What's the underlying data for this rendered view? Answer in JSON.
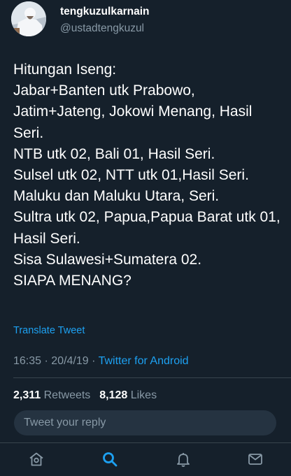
{
  "user": {
    "display_name": "tengkuzulkarnain",
    "handle": "@ustadtengkuzul"
  },
  "tweet": {
    "text": "Hitungan Iseng:\nJabar+Banten utk Prabowo,\nJatim+Jateng, Jokowi Menang, Hasil Seri.\nNTB utk 02, Bali 01, Hasil Seri.\nSulsel utk 02, NTT utk 01,Hasil Seri.\nMaluku dan Maluku Utara, Seri.\nSultra utk 02, Papua,Papua Barat utk 01, Hasil Seri.\nSisa Sulawesi+Sumatera 02.\nSIAPA MENANG?",
    "translate_label": "Translate Tweet",
    "time": "16:35",
    "date": "20/4/19",
    "separator": "·",
    "source": "Twitter for Android"
  },
  "stats": {
    "retweets_count": "2,311",
    "retweets_label": "Retweets",
    "likes_count": "8,128",
    "likes_label": "Likes"
  },
  "reply": {
    "placeholder": "Tweet your reply"
  },
  "nav": {
    "items": [
      {
        "icon": "home-icon",
        "active": false
      },
      {
        "icon": "search-icon",
        "active": true
      },
      {
        "icon": "notifications-icon",
        "active": false
      },
      {
        "icon": "messages-icon",
        "active": false
      }
    ]
  },
  "colors": {
    "background": "#15202b",
    "accent": "#1da1f2",
    "secondary_text": "#8899a6",
    "divider": "#38444d"
  }
}
